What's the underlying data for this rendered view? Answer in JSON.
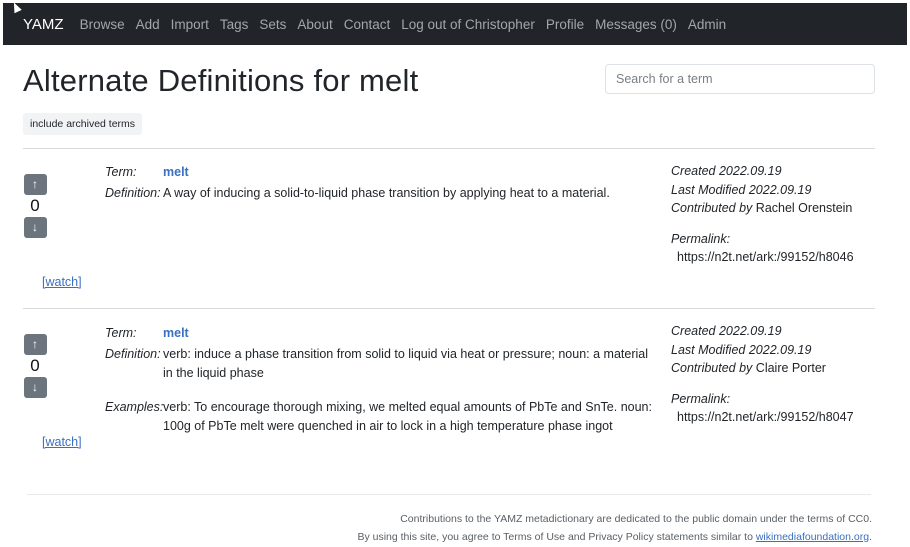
{
  "navbar": {
    "brand": "YAMZ",
    "links": [
      "Browse",
      "Add",
      "Import",
      "Tags",
      "Sets",
      "About",
      "Contact",
      "Log out of Christopher",
      "Profile",
      "Messages (0)",
      "Admin"
    ]
  },
  "page": {
    "title": "Alternate Definitions for melt",
    "search_placeholder": "Search for a term",
    "archived_button": "include archived terms"
  },
  "labels": {
    "term": "Term:",
    "definition": "Definition:",
    "examples": "Examples:",
    "created": "Created",
    "last_modified": "Last Modified",
    "contributed_by": "Contributed by",
    "permalink": "Permalink:",
    "watch": "[watch]",
    "up_icon": "↑",
    "down_icon": "↓"
  },
  "entries": [
    {
      "votes": "0",
      "term": "melt",
      "definition": "A way of inducing a solid-to-liquid phase transition by applying heat to a material.",
      "examples": null,
      "created": "2022.09.19",
      "last_modified": "2022.09.19",
      "contributor": "Rachel Orenstein",
      "permalink": "https://n2t.net/ark:/99152/h8046"
    },
    {
      "votes": "0",
      "term": "melt",
      "definition": "verb: induce a phase transition from solid to liquid via heat or pressure; noun: a material in the liquid phase",
      "examples": "verb: To encourage thorough mixing, we melted equal amounts of PbTe and SnTe. noun: 100g of PbTe melt were quenched in air to lock in a high temperature phase ingot",
      "created": "2022.09.19",
      "last_modified": "2022.09.19",
      "contributor": "Claire Porter",
      "permalink": "https://n2t.net/ark:/99152/h8047"
    }
  ],
  "footer": {
    "line1": "Contributions to the YAMZ metadictionary are dedicated to the public domain under the terms of CC0.",
    "line2_prefix": "By using this site, you agree to Terms of Use and Privacy Policy statements similar to ",
    "line2_link": "wikimediafoundation.org",
    "line2_suffix": "."
  }
}
